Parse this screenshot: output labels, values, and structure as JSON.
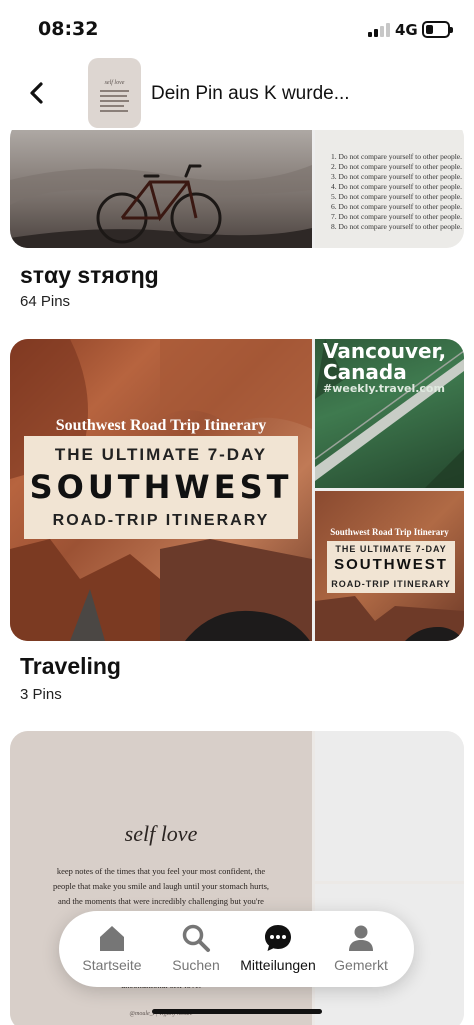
{
  "status": {
    "time": "08:32",
    "network": "4G"
  },
  "header": {
    "title": "Dein Pin aus K wurde...",
    "back_icon": "chevron-left-icon",
    "thumb_title": "self love"
  },
  "boards": [
    {
      "name": "sтαy sтяσηg",
      "count": "64 Pins",
      "rules": [
        "1. Do not compare yourself to other people.",
        "2. Do not compare yourself to other people.",
        "3. Do not compare yourself to other people.",
        "4. Do not compare yourself to other people.",
        "5. Do not compare yourself to other people.",
        "6. Do not compare yourself to other people.",
        "7. Do not compare yourself to other people.",
        "8. Do not compare yourself to other people."
      ]
    },
    {
      "name": "Traveling",
      "count": "3 Pins",
      "itinerary": {
        "title": "Southwest Road Trip Itinerary",
        "line1": "THE ULTIMATE 7-DAY",
        "line2": "SOUTHWEST",
        "line3": "ROAD-TRIP ITINERARY"
      },
      "vancouver": {
        "title": "Vancouver, Canada",
        "site": "#weekly.travel.com"
      }
    },
    {
      "self_love": {
        "title": "self love",
        "text": "keep notes of the times that you feel your most confident, the people that make you smile and laugh until your stomach hurts, and the moments that were incredibly challenging but you're thankful for",
        "closing": "unconditional self love.",
        "signature": "@moule_t | Tiffany Moule"
      }
    }
  ],
  "nav": {
    "items": [
      {
        "label": "Startseite",
        "icon": "home-icon",
        "active": false
      },
      {
        "label": "Suchen",
        "icon": "search-icon",
        "active": false
      },
      {
        "label": "Mitteilungen",
        "icon": "chat-bubble-icon",
        "active": true
      },
      {
        "label": "Gemerkt",
        "icon": "profile-icon",
        "active": false
      }
    ]
  }
}
